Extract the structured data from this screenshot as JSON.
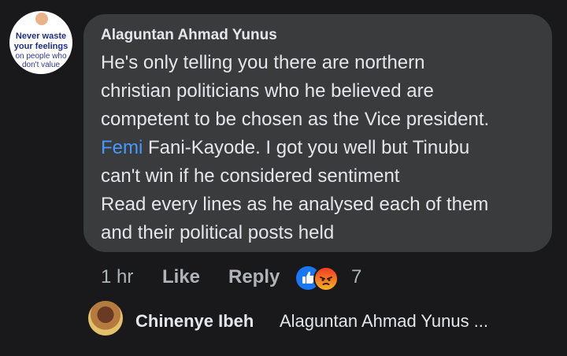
{
  "comment": {
    "avatar": {
      "lines": [
        "Never waste",
        "your feelings",
        "on people who",
        "don't value"
      ]
    },
    "author": "Alaguntan Ahmad Yunus",
    "body": {
      "line1": "He's only telling you there are northern",
      "line2": "christian politicians who he believed are",
      "line3": "competent to be chosen as the Vice president.",
      "mention": "Femi",
      "line4_rest": " Fani-Kayode. I got you well but Tinubu",
      "line5": "can't win if he considered sentiment",
      "line6": "Read every lines as he analysed each of them",
      "line7": "and their political posts held"
    },
    "actions": {
      "time": "1 hr",
      "like_label": "Like",
      "reply_label": "Reply",
      "reaction_count": "7",
      "reaction_icons": [
        "like-reaction",
        "angry-reaction"
      ]
    }
  },
  "reply_preview": {
    "author": "Chinenye Ibeh",
    "text": "Alaguntan Ahmad Yunus ..."
  },
  "colors": {
    "background": "#19191b",
    "bubble": "#3a3b3c",
    "text": "#e4e6eb",
    "secondary_text": "#b0b3b8",
    "mention": "#4599ff",
    "like_blue": "#1877f2"
  }
}
